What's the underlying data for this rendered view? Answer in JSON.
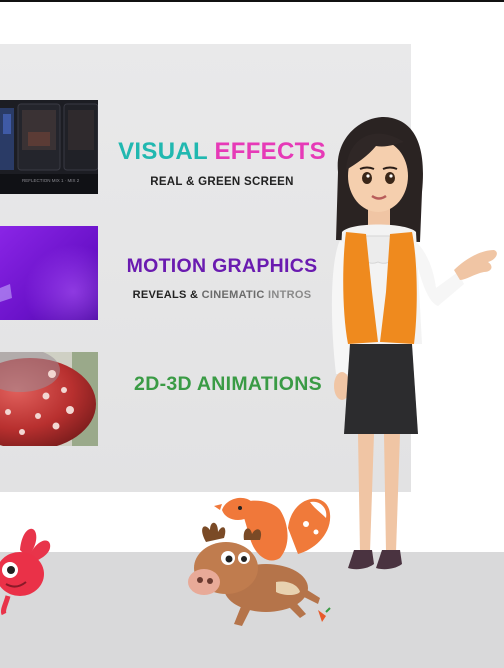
{
  "services": {
    "vfx": {
      "title_part1": "VISUAL",
      "title_part2": "EFFECTS",
      "subtitle": "REAL & GREEN SCREEN",
      "colors": {
        "part1": "#21b8b0",
        "part2": "#e63ab7",
        "subtitle": "#222222"
      }
    },
    "motion_graphics": {
      "title": "MOTION GRAPHICS",
      "subtitle_part1": "REVEALS &",
      "subtitle_part2": "CINEMATIC",
      "subtitle_part3": "INTROS",
      "colors": {
        "title": "#6a1bb0"
      }
    },
    "animation": {
      "title": "2D-3D ANIMATIONS",
      "colors": {
        "title": "#3a9b45"
      }
    }
  },
  "vfx_thumb_caption": "REFLECTION MIX 1  ·  MIX 2",
  "images": {
    "vfx_thumb": "dark-film-frames-image",
    "mg_thumb": "purple-gradient-image",
    "anim_thumb": "red-ball-image",
    "presenter": "woman-presenter-illustration",
    "bunny": "red-bunny-mascot",
    "critters": "fox-riding-moose-illustration"
  }
}
